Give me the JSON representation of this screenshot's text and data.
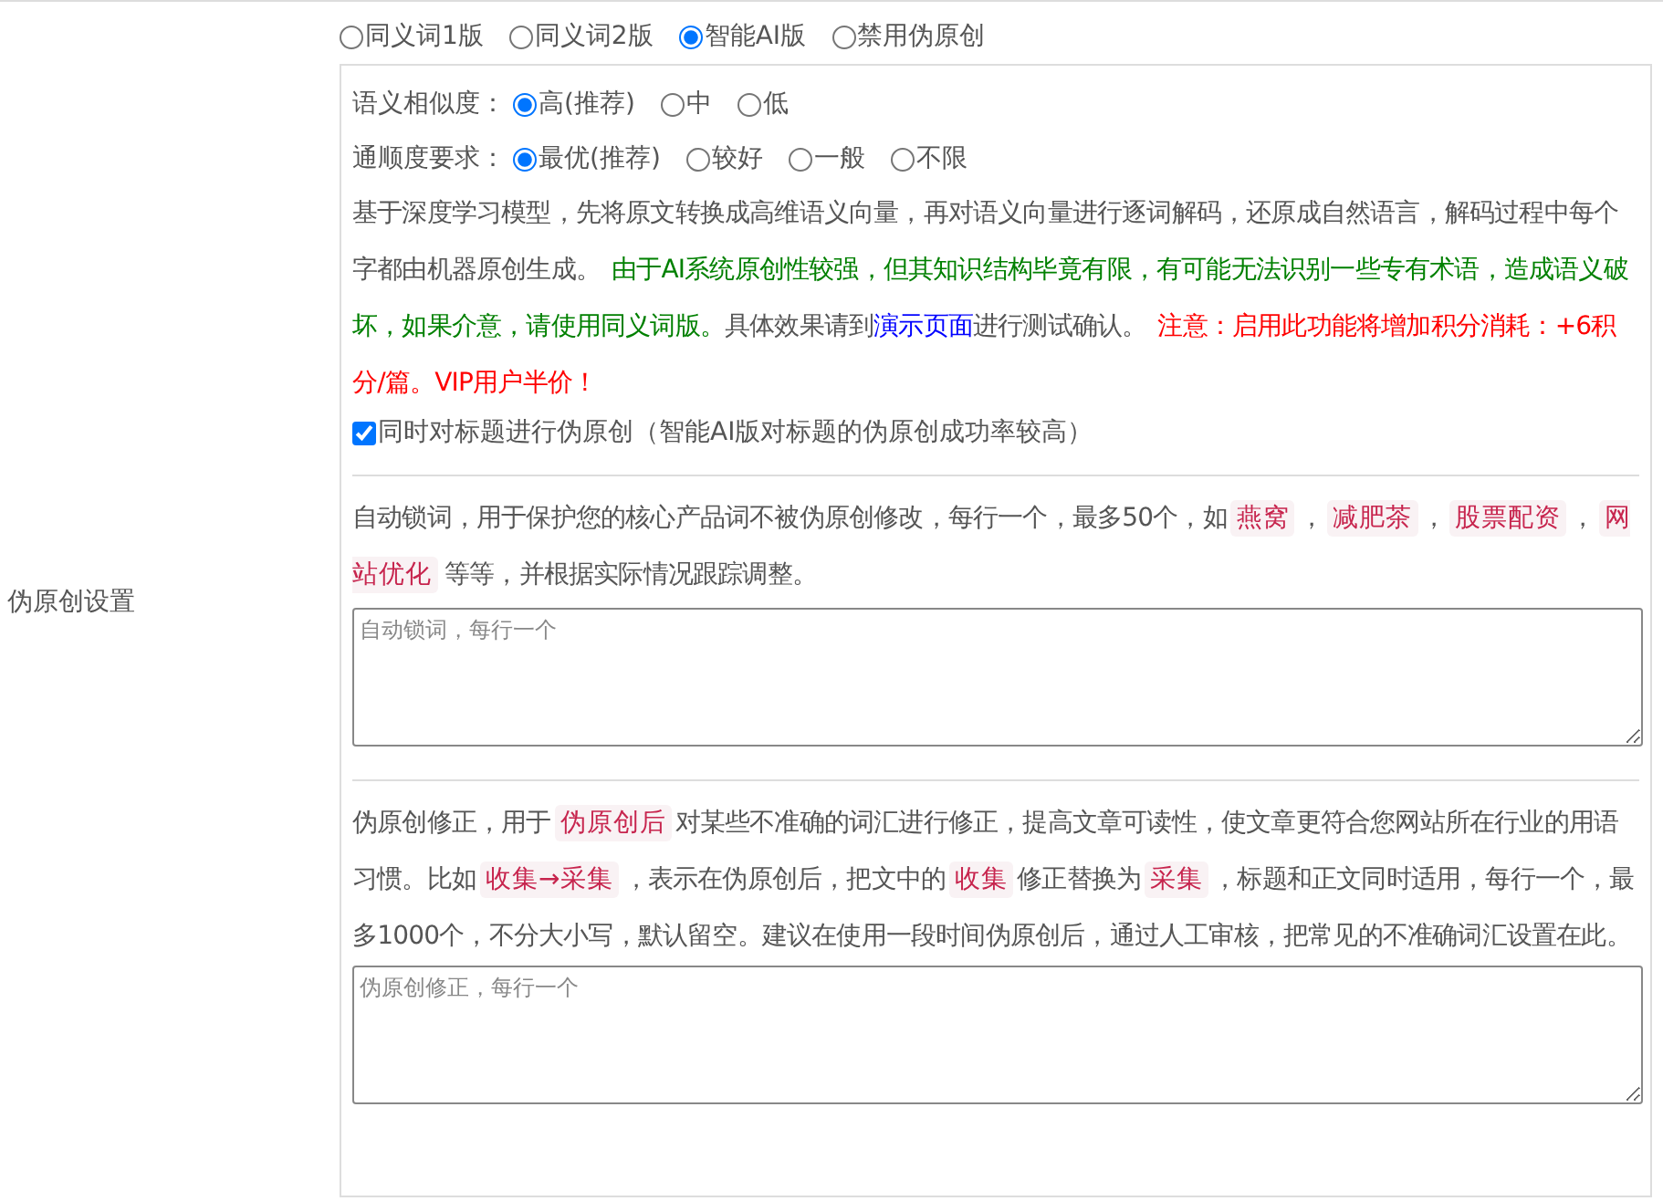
{
  "section_label": "伪原创设置",
  "mode_options": [
    {
      "label": "同义词1版",
      "selected": false
    },
    {
      "label": "同义词2版",
      "selected": false
    },
    {
      "label": "智能AI版",
      "selected": true
    },
    {
      "label": "禁用伪原创",
      "selected": false
    }
  ],
  "similarity": {
    "label": "语义相似度：",
    "options": [
      {
        "label": "高(推荐)",
        "selected": true
      },
      {
        "label": "中",
        "selected": false
      },
      {
        "label": "低",
        "selected": false
      }
    ]
  },
  "fluency": {
    "label": "通顺度要求：",
    "options": [
      {
        "label": "最优(推荐)",
        "selected": true
      },
      {
        "label": "较好",
        "selected": false
      },
      {
        "label": "一般",
        "selected": false
      },
      {
        "label": "不限",
        "selected": false
      }
    ]
  },
  "description": [
    {
      "kind": "plain",
      "text": "基于深度学习模型，先将原文转换成高维语义向量，再对语义向量进行逐词解码，还原成自然语言，解码过程中每个字都由机器原创生成。"
    },
    {
      "kind": "warning",
      "text": "由于AI系统原创性较强，但其知识结构毕竟有限，有可能无法识别一些专有术语，造成语义破坏，如果介意，请使用同义词版。"
    },
    {
      "kind": "plain",
      "text": "具体效果请到"
    },
    {
      "kind": "link",
      "text": "演示页面"
    },
    {
      "kind": "joined",
      "text": "进行测试确认。"
    },
    {
      "kind": "alert",
      "text": "注意：启用此功能将增加积分消耗：+6积分/篇。VIP用户半价！"
    }
  ],
  "title_rewrite": {
    "label": "同时对标题进行伪原创（智能AI版对标题的伪原创成功率较高）",
    "checked": true
  },
  "lock_words": {
    "segments": [
      {
        "kind": "plain",
        "text": "自动锁词，用于保护您的核心产品词不被伪原创修改，每行一个，最多50个，如"
      },
      {
        "kind": "tag",
        "text": "燕窝"
      },
      {
        "kind": "joined",
        "text": "，"
      },
      {
        "kind": "tag",
        "text": "减肥茶"
      },
      {
        "kind": "joined",
        "text": "，"
      },
      {
        "kind": "tag",
        "text": "股票配资"
      },
      {
        "kind": "joined",
        "text": "，"
      },
      {
        "kind": "tag",
        "text": "网站优化"
      },
      {
        "kind": "plain",
        "text": "等等，并根据实际情况跟踪调整。"
      }
    ],
    "placeholder": "自动锁词，每行一个"
  },
  "corrections": {
    "segments": [
      {
        "kind": "plain",
        "text": "伪原创修正，用于"
      },
      {
        "kind": "tag",
        "text": "伪原创后"
      },
      {
        "kind": "joined",
        "text": "对某些不准确的词汇进行修正，提高文章可读性，使文章更符合您网站所在行业的用语习惯。比如"
      },
      {
        "kind": "tag",
        "text": "收集→采集"
      },
      {
        "kind": "joined",
        "text": "，表示在伪原创后，把文中的"
      },
      {
        "kind": "tag",
        "text": "收集"
      },
      {
        "kind": "joined",
        "text": "修正替换为"
      },
      {
        "kind": "tag",
        "text": "采集"
      },
      {
        "kind": "joined",
        "text": "，标题和正文同时适用，每行一个，最多1000个，不分大小写，默认留空。建议在使用一段时间伪原创后，通过人工审核，把常见的不准确词汇设置在此。"
      }
    ],
    "placeholder": "伪原创修正，每行一个"
  }
}
